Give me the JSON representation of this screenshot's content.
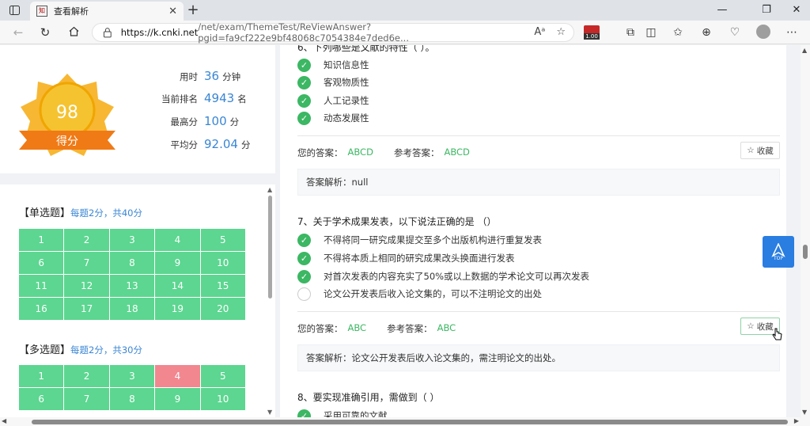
{
  "browser": {
    "tab_title": "查看解析",
    "favicon_text": "知",
    "url_host": "https://k.cnki.net",
    "url_path": "/net/exam/ThemeTest/ReViewAnswer?pgid=fa9cf222e9bf48068c7054384e7ded6e...",
    "ext_badge": "1.00"
  },
  "score": {
    "value": "98",
    "label": "得分",
    "stats": [
      {
        "label": "用时",
        "value": "36",
        "unit": "分钟"
      },
      {
        "label": "当前排名",
        "value": "4943",
        "unit": "名"
      },
      {
        "label": "最高分",
        "value": "100",
        "unit": "分"
      },
      {
        "label": "平均分",
        "value": "92.04",
        "unit": "分"
      }
    ]
  },
  "nav": {
    "single": {
      "title": "【单选题】",
      "hint": "每题2分，共40分",
      "cells": [
        "1",
        "2",
        "3",
        "4",
        "5",
        "6",
        "7",
        "8",
        "9",
        "10",
        "11",
        "12",
        "13",
        "14",
        "15",
        "16",
        "17",
        "18",
        "19",
        "20"
      ]
    },
    "multi": {
      "title": "【多选题】",
      "hint": "每题2分，共30分",
      "cells": [
        "1",
        "2",
        "3",
        "4",
        "5",
        "6",
        "7",
        "8",
        "9",
        "10"
      ],
      "wrong_index": 3
    }
  },
  "questions": {
    "q6": {
      "title": "6、下列哪些是文献的特性（ ）。",
      "options": [
        "知识信息性",
        "客观物质性",
        "人工记录性",
        "动态发展性"
      ],
      "your_label": "您的答案：",
      "your_answer": "ABCD",
      "ref_label": "参考答案：",
      "ref_answer": "ABCD",
      "analysis": "答案解析：null",
      "fav": "收藏"
    },
    "q7": {
      "title": "7、关于学术成果发表，以下说法正确的是 （）",
      "options": [
        "不得将同一研究成果提交至多个出版机构进行重复发表",
        "不得将本质上相同的研究成果改头换面进行发表",
        "对首次发表的内容充实了50%或以上数据的学术论文可以再次发表",
        "论文公开发表后收入论文集的，可以不注明论文的出处"
      ],
      "your_label": "您的答案：",
      "your_answer": "ABC",
      "ref_label": "参考答案：",
      "ref_answer": "ABC",
      "analysis": "答案解析：论文公开发表后收入论文集的，需注明论文的出处。",
      "fav": "收藏"
    },
    "q8": {
      "title": "8、要实现准确引用，需做到（ ）",
      "options": [
        "采用可靠的文献"
      ]
    }
  },
  "top_button": "TOP",
  "colors": {
    "accent": "#3a86d4",
    "correct": "#3cb763",
    "cell": "#5cd690",
    "wrong": "#f28790"
  }
}
